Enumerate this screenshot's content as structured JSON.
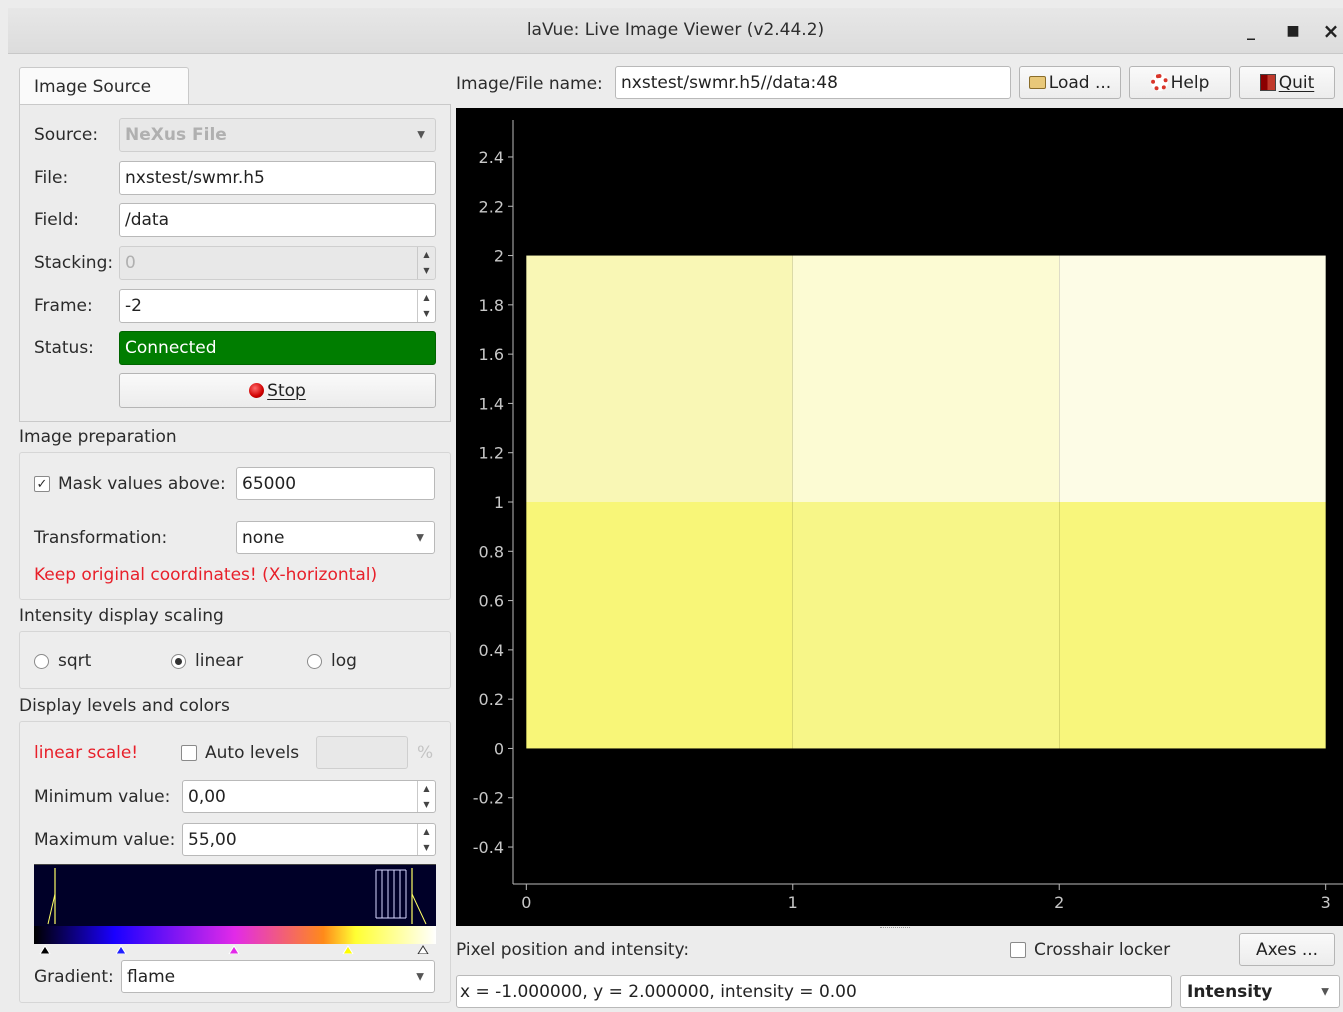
{
  "window": {
    "title": "laVue: Live Image Viewer (v2.44.2)",
    "minimize_glyph": "_",
    "maximize_glyph": "▫",
    "close_glyph": "×"
  },
  "source_tab": {
    "label": "Image Source"
  },
  "source": {
    "source_label": "Source:",
    "source_value": "NeXus File",
    "file_label": "File:",
    "file_value": "nxstest/swmr.h5",
    "field_label": "Field:",
    "field_value": "/data",
    "stacking_label": "Stacking:",
    "stacking_value": "0",
    "frame_label": "Frame:",
    "frame_value": "-2",
    "status_label": "Status:",
    "status_value": "Connected",
    "stop_label": "Stop",
    "status_color": "#007d00"
  },
  "prep": {
    "title": "Image preparation",
    "mask_label": "Mask values above:",
    "mask_checked": true,
    "mask_value": "65000",
    "transformation_label": "Transformation:",
    "transformation_value": "none",
    "warning": "Keep original coordinates! (X-horizontal)"
  },
  "scaling": {
    "title": "Intensity display scaling",
    "options": [
      "sqrt",
      "linear",
      "log"
    ],
    "selected": "linear"
  },
  "levels": {
    "title": "Display levels and colors",
    "scale_note": "linear scale!",
    "auto_label": "Auto levels",
    "auto_checked": false,
    "auto_percent": "",
    "percent_sign": "%",
    "min_label": "Minimum value:",
    "min_value": "0,00",
    "max_label": "Maximum value:",
    "max_value": "55,00",
    "gradient_label": "Gradient:",
    "gradient_value": "flame"
  },
  "top": {
    "filename_label": "Image/File name:",
    "filename_value": "nxstest/swmr.h5//data:48",
    "load_label": "Load ...",
    "help_label": "Help",
    "quit_label": "Quit"
  },
  "bottom": {
    "pixel_label": "Pixel position and intensity:",
    "crosshair_label": "Crosshair locker",
    "axes_label": "Axes ...",
    "readout": "x = -1.000000, y = 2.000000, intensity = 0.00",
    "mode_value": "Intensity"
  },
  "chart_data": {
    "type": "heatmap",
    "x_ticks": [
      "0",
      "1",
      "2",
      "3"
    ],
    "y_ticks": [
      "-0.4",
      "-0.2",
      "0",
      "0.2",
      "0.4",
      "0.6",
      "0.8",
      "1",
      "1.2",
      "1.4",
      "1.6",
      "1.8",
      "2",
      "2.2",
      "2.4"
    ],
    "xlim": [
      -0.05,
      3.05
    ],
    "ylim": [
      -0.55,
      2.55
    ],
    "cells": [
      {
        "x0": 0,
        "x1": 1,
        "y0": 0,
        "y1": 1,
        "color": "#f8f678"
      },
      {
        "x0": 1,
        "x1": 2,
        "y0": 0,
        "y1": 1,
        "color": "#f7f688"
      },
      {
        "x0": 2,
        "x1": 3,
        "y0": 0,
        "y1": 1,
        "color": "#f8f67c"
      },
      {
        "x0": 0,
        "x1": 1,
        "y0": 1,
        "y1": 2,
        "color": "#f9f7b5"
      },
      {
        "x0": 1,
        "x1": 2,
        "y0": 1,
        "y1": 2,
        "color": "#fcfbd3"
      },
      {
        "x0": 2,
        "x1": 3,
        "y0": 1,
        "y1": 2,
        "color": "#fdfce6"
      }
    ],
    "gradient_stops": [
      "#000000",
      "#1a00ff",
      "#e22ae8",
      "#ff8a1a",
      "#ffff33",
      "#ffffff"
    ]
  }
}
